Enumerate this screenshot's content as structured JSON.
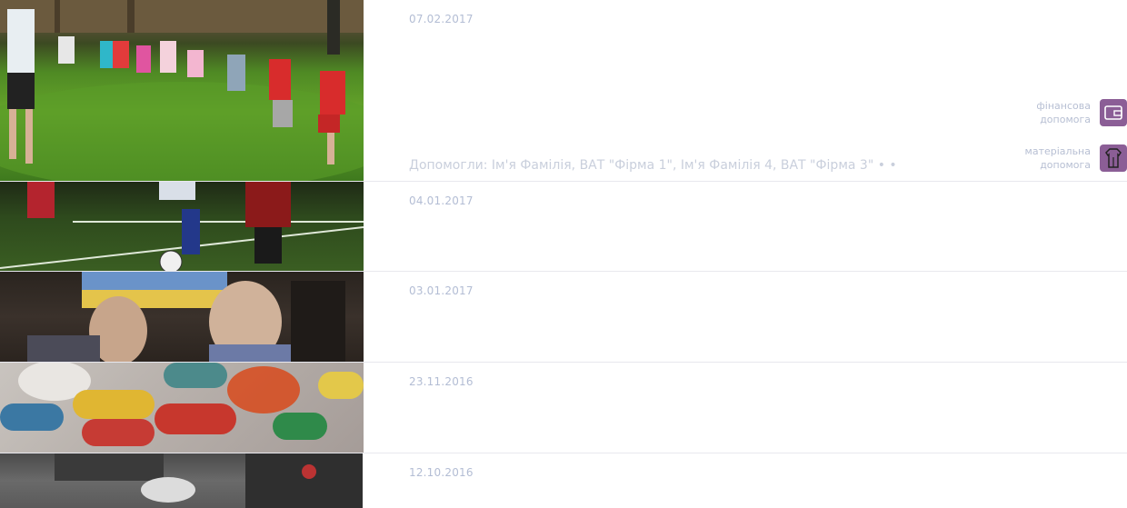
{
  "posts": [
    {
      "date": "07.02.2017",
      "helpers": "Допомогли: Ім'я Фамілія, ВАТ \"Фірма 1\", Ім'я Фамілія 4, ВАТ \"Фірма 3\" • •",
      "aid": [
        {
          "label_line1": "фінансова",
          "label_line2": "допомога",
          "icon": "wallet-icon"
        },
        {
          "label_line1": "матеріальна",
          "label_line2": "допомога",
          "icon": "clothes-icon"
        }
      ]
    },
    {
      "date": "04.01.2017"
    },
    {
      "date": "03.01.2017"
    },
    {
      "date": "23.11.2016"
    },
    {
      "date": "12.10.2016"
    }
  ],
  "colors": {
    "accent": "#8b5e96",
    "date": "#b3bdd4",
    "divider": "#e8e8ee"
  }
}
